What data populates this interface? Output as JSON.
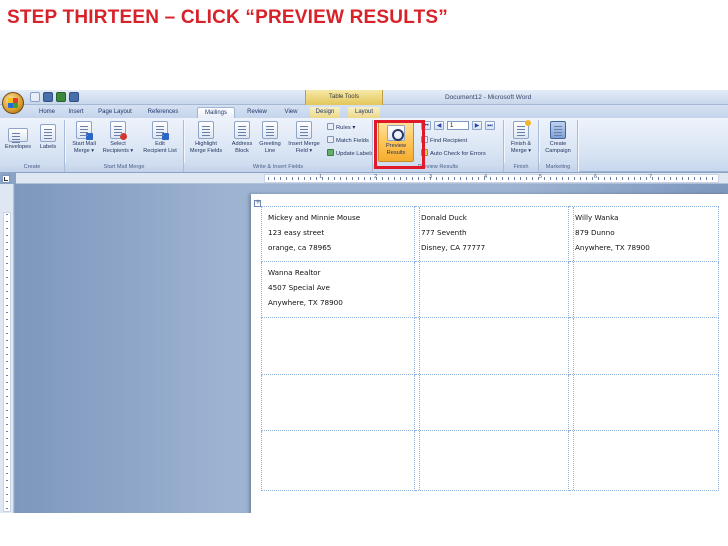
{
  "slide": {
    "title": "STEP THIRTEEN – CLICK “PREVIEW RESULTS”"
  },
  "window": {
    "title": "Document12 - Microsoft Word",
    "context_tab": "Table Tools"
  },
  "tabs": [
    {
      "label": "Home"
    },
    {
      "label": "Insert"
    },
    {
      "label": "Page Layout"
    },
    {
      "label": "References"
    },
    {
      "label": "Mailings"
    },
    {
      "label": "Review"
    },
    {
      "label": "View"
    },
    {
      "label": "Design"
    },
    {
      "label": "Layout"
    }
  ],
  "ribbon": {
    "create": {
      "envelopes": "Envelopes",
      "labels": "Labels",
      "group": "Create"
    },
    "start": {
      "start_mail_merge": [
        "Start Mail",
        "Merge ▾"
      ],
      "select_recipients": [
        "Select",
        "Recipients ▾"
      ],
      "edit_list": [
        "Edit",
        "Recipient List"
      ],
      "group": "Start Mail Merge"
    },
    "write": {
      "highlight": [
        "Highlight",
        "Merge Fields"
      ],
      "address": [
        "Address",
        "Block"
      ],
      "greeting": [
        "Greeting",
        "Line"
      ],
      "insert_field": [
        "Insert Merge",
        "Field ▾"
      ],
      "rules": "Rules ▾",
      "match": "Match Fields",
      "update": "Update Labels",
      "group": "Write & Insert Fields"
    },
    "preview": {
      "button": [
        "Preview",
        "Results"
      ],
      "record": "1",
      "find": "Find Recipient",
      "auto_check": "Auto Check for Errors",
      "group": "Preview Results"
    },
    "finish": {
      "button": [
        "Finish &",
        "Merge ▾"
      ],
      "group": "Finish"
    },
    "marketing": {
      "button": [
        "Create",
        "Campaign"
      ],
      "group": "Marketing"
    }
  },
  "ruler": {
    "numbers": [
      "1",
      "2",
      "3",
      "4",
      "5",
      "6",
      "7"
    ]
  },
  "labels": [
    {
      "lines": [
        "Mickey and Minnie Mouse",
        "123 easy street",
        "orange, ca 78965"
      ]
    },
    {
      "lines": [
        "Donald Duck",
        "777 Seventh",
        "Disney, CA 77777"
      ]
    },
    {
      "lines": [
        "Willy Wanka",
        "879 Dunno",
        "Anywhere, TX 78900"
      ]
    },
    {
      "lines": [
        "Wanna Realtor",
        "4507 Special Ave",
        "Anywhere, TX 78900"
      ]
    },
    {
      "lines": []
    },
    {
      "lines": []
    },
    {
      "lines": []
    },
    {
      "lines": []
    },
    {
      "lines": []
    },
    {
      "lines": []
    },
    {
      "lines": []
    },
    {
      "lines": []
    },
    {
      "lines": []
    },
    {
      "lines": []
    },
    {
      "lines": []
    }
  ]
}
